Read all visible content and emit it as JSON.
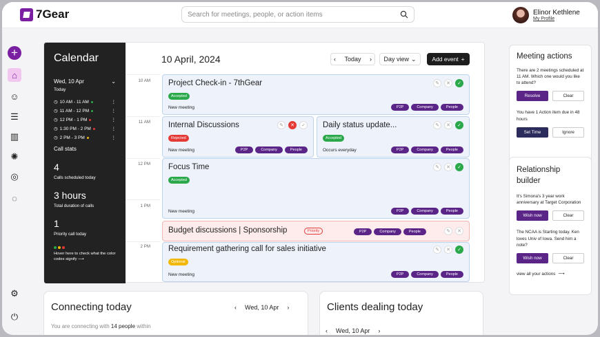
{
  "app": {
    "name": "7Gear"
  },
  "search": {
    "placeholder": "Search for meetings, people, or action items"
  },
  "profile": {
    "name": "Elinor Kethlene",
    "link": "My Profile"
  },
  "calendar": {
    "title": "Calendar",
    "selected_date": "Wed, 10 Apr",
    "today_label": "Today",
    "slots": [
      {
        "time": "10 AM - 11 AM",
        "color": "#2aa84a"
      },
      {
        "time": "11 AM - 12 PM",
        "color": "#2aa84a"
      },
      {
        "time": "12 PM - 1 PM",
        "color": "#e53935"
      },
      {
        "time": "1:30 PM - 2 PM",
        "color": "#e53935"
      },
      {
        "time": "2 PM - 3 PM",
        "color": "#f2b705"
      }
    ],
    "call_stats_label": "Call stats",
    "stats": [
      {
        "value": "4",
        "caption": "Calls scheduled today"
      },
      {
        "value": "3 hours",
        "caption": "Total duration of calls"
      },
      {
        "value": "1",
        "caption": "Priority call today"
      }
    ],
    "hint": "Hover here to check what the color codes signify",
    "header_date": "10 April, 2024",
    "today_button": "Today",
    "view_select": "Day view",
    "add_event": "Add event",
    "hours": [
      "10 AM",
      "11 AM",
      "12 PM",
      "1 PM",
      "2 PM"
    ],
    "events": [
      {
        "title": "Project Check-in - 7thGear",
        "status": "Accepted",
        "note": "New meeting",
        "tags": [
          "P2P",
          "Company",
          "People"
        ]
      },
      {
        "title": "Internal Discussions",
        "status": "Rejected",
        "note": "New meeting",
        "tags": [
          "P2P",
          "Company",
          "People"
        ]
      },
      {
        "title": "Daily status update...",
        "status": "Accepted",
        "note": "Occurs everyday",
        "tags": [
          "P2P",
          "Company",
          "People"
        ]
      },
      {
        "title": "Focus Time",
        "status": "Accepted",
        "note": "New meeting",
        "tags": [
          "P2P",
          "Company",
          "People"
        ]
      },
      {
        "title": "Budget discussions | Sponsorship",
        "status": "Priority",
        "note": "",
        "tags": [
          "P2P",
          "Company",
          "People"
        ]
      },
      {
        "title": "Requirement gathering call for sales initiative",
        "status": "Optional",
        "note": "New meeting",
        "tags": [
          "P2P",
          "Company",
          "People"
        ]
      }
    ]
  },
  "meeting_actions": {
    "title": "Meeting actions",
    "items": [
      {
        "text": "There are 2 meetings scheduled at 11 AM. Which one would you like to attend?",
        "primary": "Resolve",
        "secondary": "Clear"
      },
      {
        "text": "You have 1 Action item due in 48 hours",
        "primary": "Set Time",
        "secondary": "Ignore"
      }
    ]
  },
  "relationship_builder": {
    "title": "Relationship builder",
    "items": [
      {
        "text": "It's Simona's 3 year work anniversary at Target Corporation",
        "primary": "Wish now",
        "secondary": "Clear"
      },
      {
        "text": "The NCAA is Starting today. Ken loves Univ of Iowa. Send him a note?",
        "primary": "Wish now",
        "secondary": "Clear"
      }
    ],
    "view_all": "view all your actions"
  },
  "connecting": {
    "title": "Connecting today",
    "date": "Wed, 10 Apr",
    "desc_prefix": "You are connecting with",
    "count": "14 people",
    "desc_suffix": "within"
  },
  "clients": {
    "title": "Clients dealing today",
    "date": "Wed, 10 Apr"
  }
}
